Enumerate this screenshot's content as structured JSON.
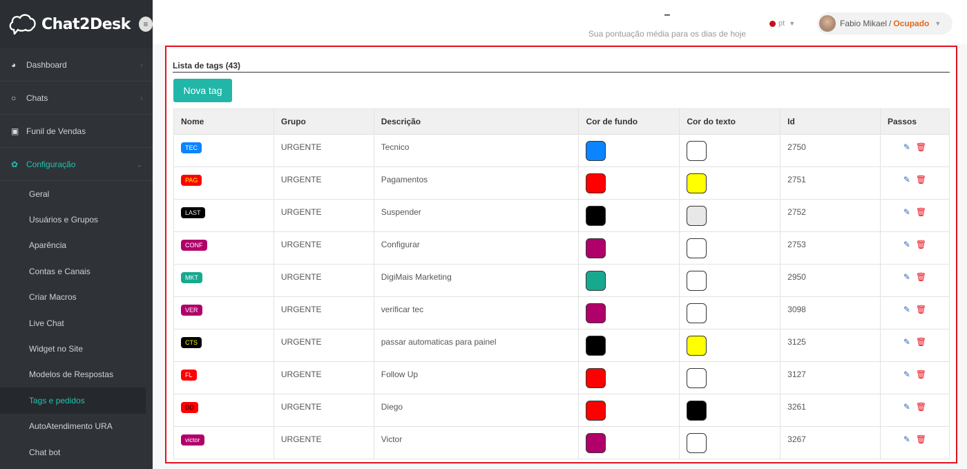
{
  "brand": {
    "name": "Chat2Desk"
  },
  "sidebar": {
    "menu": [
      {
        "label": "Dashboard",
        "icon": "dashboard-icon"
      },
      {
        "label": "Chats",
        "icon": "chat-bubble-icon"
      },
      {
        "label": "Funil de Vendas",
        "icon": "money-icon"
      },
      {
        "label": "Configuração",
        "icon": "gear-icon"
      }
    ],
    "submenu": [
      "Geral",
      "Usuários e Grupos",
      "Aparência",
      "Contas e Canais",
      "Criar Macros",
      "Live Chat",
      "Widget no Site",
      "Modelos de Respostas",
      "Tags e pedidos",
      "AutoAtendimento URA",
      "Chat bot"
    ],
    "selected_submenu": "Tags e pedidos"
  },
  "header": {
    "score_value": "–",
    "score_label": "Sua pontuação média para os dias de hoje",
    "language": "pt",
    "user_name": "Fabio Mikael",
    "user_status": "Ocupado"
  },
  "main": {
    "list_title": "Lista de tags (43)",
    "new_tag_button": "Nova tag",
    "columns": [
      "Nome",
      "Grupo",
      "Descrição",
      "Cor de fundo",
      "Cor do texto",
      "Id",
      "Passos"
    ],
    "rows": [
      {
        "name": "TEC",
        "group": "URGENTE",
        "description": "Tecnico",
        "bg": "#0a84ff",
        "fg": "#ffffff",
        "id": "2750"
      },
      {
        "name": "PAG",
        "group": "URGENTE",
        "description": "Pagamentos",
        "bg": "#ff0000",
        "fg": "#ffff00",
        "id": "2751"
      },
      {
        "name": "LAST",
        "group": "URGENTE",
        "description": "Suspender",
        "bg": "#000000",
        "fg": "#e8e8e8",
        "id": "2752"
      },
      {
        "name": "CONF",
        "group": "URGENTE",
        "description": "Configurar",
        "bg": "#b0006a",
        "fg": "#ffffff",
        "id": "2753"
      },
      {
        "name": "MKT",
        "group": "URGENTE",
        "description": "DigiMais Marketing",
        "bg": "#17a98f",
        "fg": "#ffffff",
        "id": "2950"
      },
      {
        "name": "VER",
        "group": "URGENTE",
        "description": "verificar tec",
        "bg": "#b0006a",
        "fg": "#ffffff",
        "id": "3098"
      },
      {
        "name": "CTS",
        "group": "URGENTE",
        "description": "passar automaticas para painel",
        "bg": "#000000",
        "fg": "#ffff00",
        "id": "3125"
      },
      {
        "name": "FL",
        "group": "URGENTE",
        "description": "Follow Up",
        "bg": "#ff0000",
        "fg": "#ffffff",
        "id": "3127"
      },
      {
        "name": "DD",
        "group": "URGENTE",
        "description": "Diego",
        "bg": "#ff0000",
        "fg": "#000000",
        "id": "3261"
      },
      {
        "name": "victor",
        "group": "URGENTE",
        "description": "Victor",
        "bg": "#b0006a",
        "fg": "#ffffff",
        "id": "3267"
      }
    ]
  }
}
